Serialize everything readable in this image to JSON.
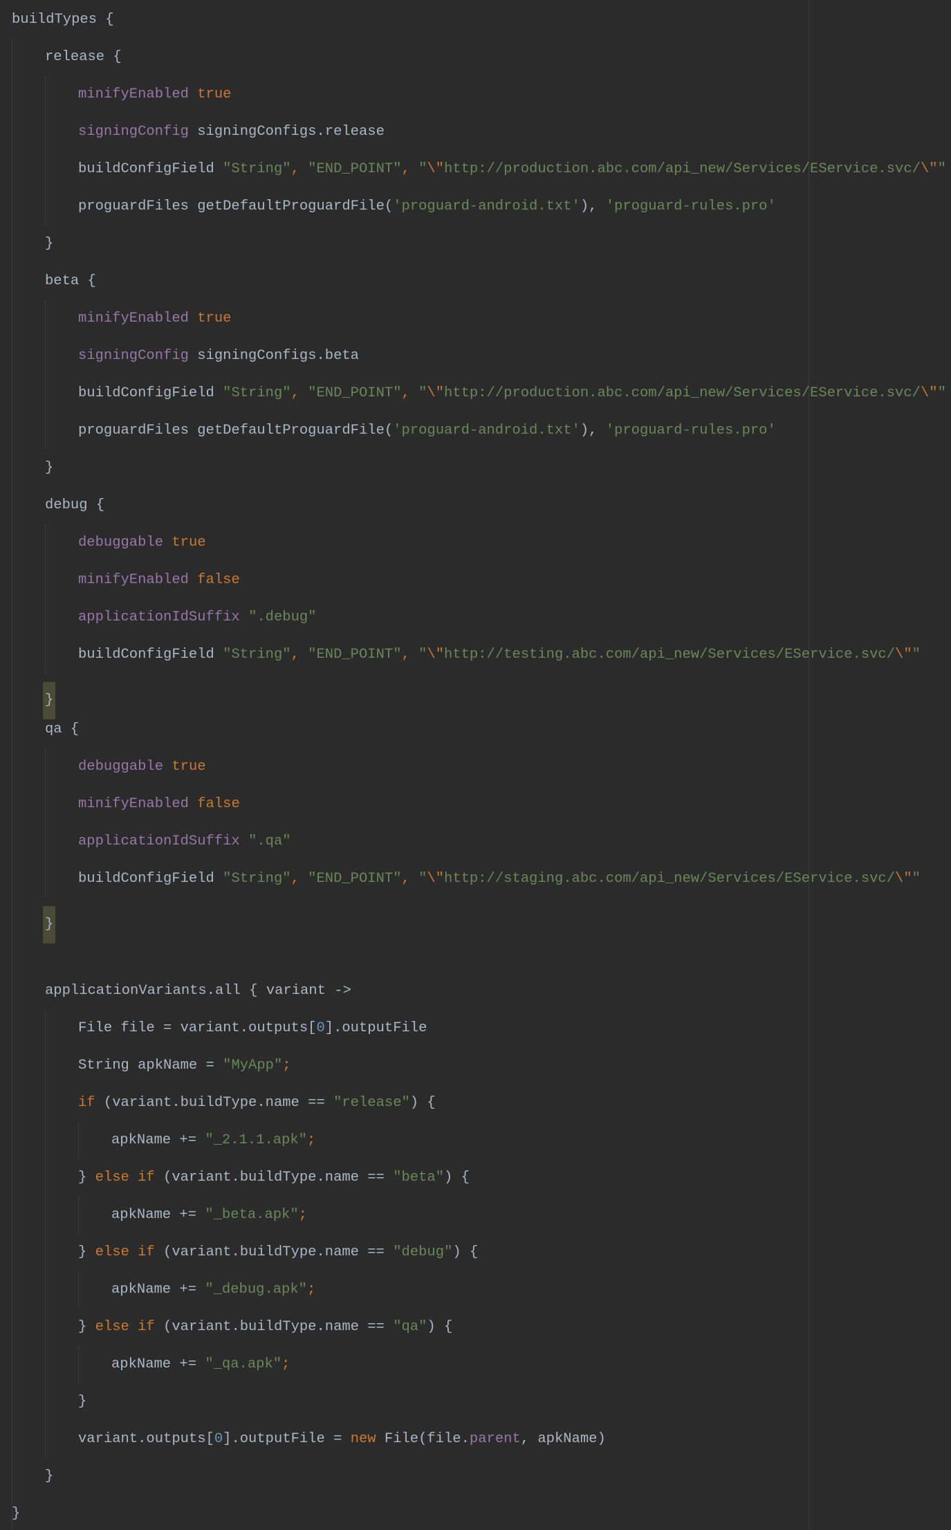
{
  "editor": {
    "lines": [
      {
        "indent": 0,
        "tokens": [
          {
            "t": "buildTypes {",
            "c": "p"
          }
        ]
      },
      {
        "indent": 1,
        "tokens": [
          {
            "t": "release {",
            "c": "p"
          }
        ]
      },
      {
        "indent": 2,
        "tokens": [
          {
            "t": "minifyEnabled",
            "c": "m"
          },
          {
            "t": " ",
            "c": "p"
          },
          {
            "t": "true",
            "c": "k"
          }
        ]
      },
      {
        "indent": 2,
        "tokens": [
          {
            "t": "signingConfig",
            "c": "m"
          },
          {
            "t": " signingConfigs.release",
            "c": "p"
          }
        ]
      },
      {
        "indent": 2,
        "tokens": [
          {
            "t": "buildConfigField ",
            "c": "p"
          },
          {
            "t": "\"String\"",
            "c": "s"
          },
          {
            "t": ", ",
            "c": "k"
          },
          {
            "t": "\"END_POINT\"",
            "c": "s"
          },
          {
            "t": ", ",
            "c": "k"
          },
          {
            "t": "\"",
            "c": "s"
          },
          {
            "t": "\\\"",
            "c": "e"
          },
          {
            "t": "http://production.abc.com/api_new/Services/EService.svc/",
            "c": "s"
          },
          {
            "t": "\\\"",
            "c": "e"
          },
          {
            "t": "\"",
            "c": "s"
          }
        ]
      },
      {
        "indent": 2,
        "tokens": [
          {
            "t": "proguardFiles getDefaultProguardFile(",
            "c": "p"
          },
          {
            "t": "'proguard-android.txt'",
            "c": "s"
          },
          {
            "t": "), ",
            "c": "p"
          },
          {
            "t": "'proguard-rules.pro'",
            "c": "s"
          }
        ]
      },
      {
        "indent": 1,
        "tokens": [
          {
            "t": "}",
            "c": "p"
          }
        ]
      },
      {
        "indent": 1,
        "tokens": [
          {
            "t": "beta {",
            "c": "p"
          }
        ]
      },
      {
        "indent": 2,
        "tokens": [
          {
            "t": "minifyEnabled",
            "c": "m"
          },
          {
            "t": " ",
            "c": "p"
          },
          {
            "t": "true",
            "c": "k"
          }
        ]
      },
      {
        "indent": 2,
        "tokens": [
          {
            "t": "signingConfig",
            "c": "m"
          },
          {
            "t": " signingConfigs.beta",
            "c": "p"
          }
        ]
      },
      {
        "indent": 2,
        "tokens": [
          {
            "t": "buildConfigField ",
            "c": "p"
          },
          {
            "t": "\"String\"",
            "c": "s"
          },
          {
            "t": ", ",
            "c": "k"
          },
          {
            "t": "\"END_POINT\"",
            "c": "s"
          },
          {
            "t": ", ",
            "c": "k"
          },
          {
            "t": "\"",
            "c": "s"
          },
          {
            "t": "\\\"",
            "c": "e"
          },
          {
            "t": "http://production.abc.com/api_new/Services/EService.svc/",
            "c": "s"
          },
          {
            "t": "\\\"",
            "c": "e"
          },
          {
            "t": "\"",
            "c": "s"
          }
        ]
      },
      {
        "indent": 2,
        "tokens": [
          {
            "t": "proguardFiles getDefaultProguardFile(",
            "c": "p"
          },
          {
            "t": "'proguard-android.txt'",
            "c": "s"
          },
          {
            "t": "), ",
            "c": "p"
          },
          {
            "t": "'proguard-rules.pro'",
            "c": "s"
          }
        ]
      },
      {
        "indent": 1,
        "tokens": [
          {
            "t": "}",
            "c": "p"
          }
        ]
      },
      {
        "indent": 1,
        "tokens": [
          {
            "t": "debug {",
            "c": "p"
          }
        ]
      },
      {
        "indent": 2,
        "tokens": [
          {
            "t": "debuggable",
            "c": "m"
          },
          {
            "t": " ",
            "c": "p"
          },
          {
            "t": "true",
            "c": "k"
          }
        ]
      },
      {
        "indent": 2,
        "tokens": [
          {
            "t": "minifyEnabled",
            "c": "m"
          },
          {
            "t": " ",
            "c": "p"
          },
          {
            "t": "false",
            "c": "k"
          }
        ]
      },
      {
        "indent": 2,
        "tokens": [
          {
            "t": "applicationIdSuffix",
            "c": "m"
          },
          {
            "t": " ",
            "c": "p"
          },
          {
            "t": "\".debug\"",
            "c": "s"
          }
        ]
      },
      {
        "indent": 2,
        "tokens": [
          {
            "t": "buildConfigField ",
            "c": "p"
          },
          {
            "t": "\"String\"",
            "c": "s"
          },
          {
            "t": ", ",
            "c": "k"
          },
          {
            "t": "\"END_POINT\"",
            "c": "s"
          },
          {
            "t": ", ",
            "c": "k"
          },
          {
            "t": "\"",
            "c": "s"
          },
          {
            "t": "\\\"",
            "c": "e"
          },
          {
            "t": "http://testing.abc.com/api_new/Services/EService.svc/",
            "c": "s"
          },
          {
            "t": "\\\"",
            "c": "e"
          },
          {
            "t": "\"",
            "c": "s"
          }
        ]
      },
      {
        "indent": 1,
        "highlight": true,
        "tokens": [
          {
            "t": "}",
            "c": "p"
          }
        ]
      },
      {
        "indent": 1,
        "tokens": [
          {
            "t": "qa {",
            "c": "p"
          }
        ]
      },
      {
        "indent": 2,
        "tokens": [
          {
            "t": "debuggable",
            "c": "m"
          },
          {
            "t": " ",
            "c": "p"
          },
          {
            "t": "true",
            "c": "k"
          }
        ]
      },
      {
        "indent": 2,
        "tokens": [
          {
            "t": "minifyEnabled",
            "c": "m"
          },
          {
            "t": " ",
            "c": "p"
          },
          {
            "t": "false",
            "c": "k"
          }
        ]
      },
      {
        "indent": 2,
        "tokens": [
          {
            "t": "applicationIdSuffix",
            "c": "m"
          },
          {
            "t": " ",
            "c": "p"
          },
          {
            "t": "\".qa\"",
            "c": "s"
          }
        ]
      },
      {
        "indent": 2,
        "tokens": [
          {
            "t": "buildConfigField ",
            "c": "p"
          },
          {
            "t": "\"String\"",
            "c": "s"
          },
          {
            "t": ", ",
            "c": "k"
          },
          {
            "t": "\"END_POINT\"",
            "c": "s"
          },
          {
            "t": ", ",
            "c": "k"
          },
          {
            "t": "\"",
            "c": "s"
          },
          {
            "t": "\\\"",
            "c": "e"
          },
          {
            "t": "http://staging.abc.com/api_new/Services/EService.svc/",
            "c": "s"
          },
          {
            "t": "\\\"",
            "c": "e"
          },
          {
            "t": "\"",
            "c": "s"
          }
        ]
      },
      {
        "indent": 1,
        "highlight": true,
        "tokens": [
          {
            "t": "}",
            "c": "p"
          }
        ]
      },
      {
        "indent": 0,
        "tokens": []
      },
      {
        "indent": 1,
        "tokens": [
          {
            "t": "applicationVariants.all { variant ->",
            "c": "p"
          }
        ]
      },
      {
        "indent": 2,
        "tokens": [
          {
            "t": "File file = variant.outputs[",
            "c": "p"
          },
          {
            "t": "0",
            "c": "n"
          },
          {
            "t": "].outputFile",
            "c": "p"
          }
        ]
      },
      {
        "indent": 2,
        "tokens": [
          {
            "t": "String apkName = ",
            "c": "p"
          },
          {
            "t": "\"MyApp\"",
            "c": "s"
          },
          {
            "t": ";",
            "c": "k"
          }
        ]
      },
      {
        "indent": 2,
        "tokens": [
          {
            "t": "if",
            "c": "k"
          },
          {
            "t": " (variant.buildType.name == ",
            "c": "p"
          },
          {
            "t": "\"release\"",
            "c": "s"
          },
          {
            "t": ") {",
            "c": "p"
          }
        ]
      },
      {
        "indent": 3,
        "tokens": [
          {
            "t": "apkName += ",
            "c": "p"
          },
          {
            "t": "\"_2.1.1.apk\"",
            "c": "s"
          },
          {
            "t": ";",
            "c": "k"
          }
        ]
      },
      {
        "indent": 2,
        "tokens": [
          {
            "t": "} ",
            "c": "p"
          },
          {
            "t": "else if",
            "c": "k"
          },
          {
            "t": " (variant.buildType.name == ",
            "c": "p"
          },
          {
            "t": "\"beta\"",
            "c": "s"
          },
          {
            "t": ") {",
            "c": "p"
          }
        ]
      },
      {
        "indent": 3,
        "tokens": [
          {
            "t": "apkName += ",
            "c": "p"
          },
          {
            "t": "\"_beta.apk\"",
            "c": "s"
          },
          {
            "t": ";",
            "c": "k"
          }
        ]
      },
      {
        "indent": 2,
        "tokens": [
          {
            "t": "} ",
            "c": "p"
          },
          {
            "t": "else if",
            "c": "k"
          },
          {
            "t": " (variant.buildType.name == ",
            "c": "p"
          },
          {
            "t": "\"debug\"",
            "c": "s"
          },
          {
            "t": ") {",
            "c": "p"
          }
        ]
      },
      {
        "indent": 3,
        "tokens": [
          {
            "t": "apkName += ",
            "c": "p"
          },
          {
            "t": "\"_debug.apk\"",
            "c": "s"
          },
          {
            "t": ";",
            "c": "k"
          }
        ]
      },
      {
        "indent": 2,
        "tokens": [
          {
            "t": "} ",
            "c": "p"
          },
          {
            "t": "else if",
            "c": "k"
          },
          {
            "t": " (variant.buildType.name == ",
            "c": "p"
          },
          {
            "t": "\"qa\"",
            "c": "s"
          },
          {
            "t": ") {",
            "c": "p"
          }
        ]
      },
      {
        "indent": 3,
        "tokens": [
          {
            "t": "apkName += ",
            "c": "p"
          },
          {
            "t": "\"_qa.apk\"",
            "c": "s"
          },
          {
            "t": ";",
            "c": "k"
          }
        ]
      },
      {
        "indent": 2,
        "tokens": [
          {
            "t": "}",
            "c": "p"
          }
        ]
      },
      {
        "indent": 2,
        "tokens": [
          {
            "t": "variant.outputs[",
            "c": "p"
          },
          {
            "t": "0",
            "c": "n"
          },
          {
            "t": "].outputFile = ",
            "c": "p"
          },
          {
            "t": "new",
            "c": "k"
          },
          {
            "t": " File(file.",
            "c": "p"
          },
          {
            "t": "parent",
            "c": "m"
          },
          {
            "t": ", apkName)",
            "c": "p"
          }
        ]
      },
      {
        "indent": 1,
        "tokens": [
          {
            "t": "}",
            "c": "p"
          }
        ]
      },
      {
        "indent": 0,
        "tokens": [
          {
            "t": "}",
            "c": "p"
          }
        ]
      }
    ]
  },
  "colors": {
    "background": "#2b2b2b",
    "plain": "#a9b7c6",
    "keyword": "#cc7832",
    "string": "#6a8759",
    "number": "#6897bb",
    "member": "#9876aa",
    "brace_highlight": "#4a4a35"
  }
}
